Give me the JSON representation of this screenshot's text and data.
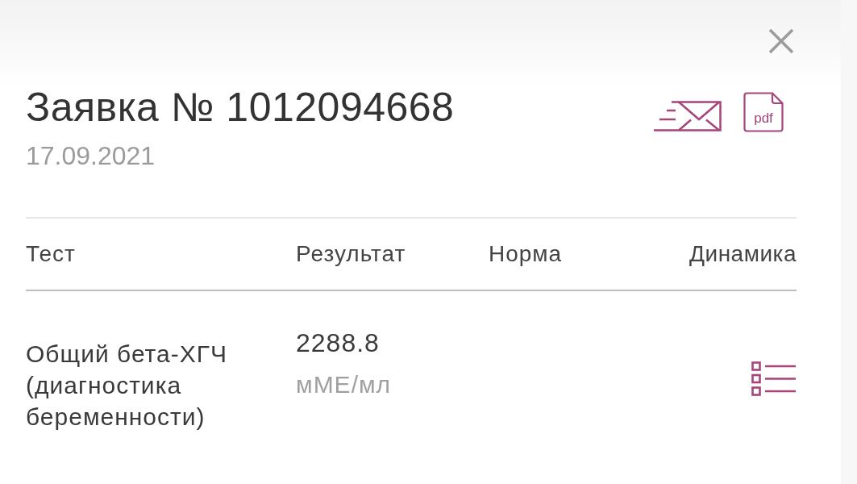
{
  "dialog": {
    "title": "Заявка № 1012094668",
    "date": "17.09.2021",
    "pdf_label": "pdf"
  },
  "table": {
    "columns": [
      "Тест",
      "Результат",
      "Норма",
      "Динамика"
    ],
    "rows": [
      {
        "test": "Общий бета-ХГЧ (диагностика беременности)",
        "result": "2288.8",
        "unit": "мМЕ/мл"
      }
    ]
  }
}
